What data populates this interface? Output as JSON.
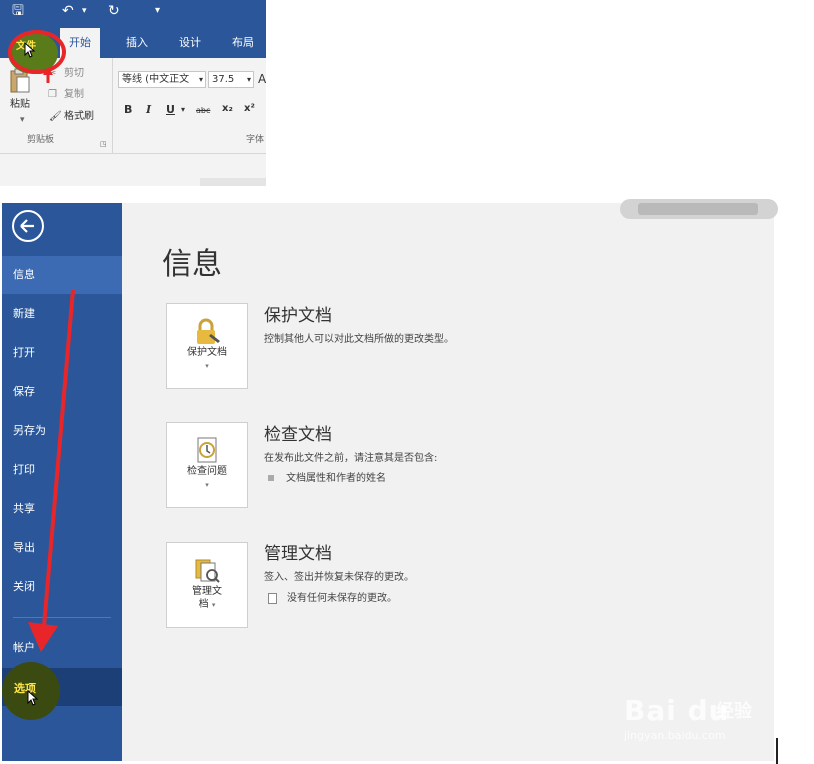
{
  "ribbon": {
    "tabs": {
      "file": "文件",
      "home": "开始",
      "insert": "插入",
      "design": "设计",
      "layout": "布局"
    },
    "clipboard": {
      "paste": "粘贴",
      "cut": "剪切",
      "copy": "复制",
      "format_painter": "格式刷",
      "group_label": "剪贴板"
    },
    "font": {
      "name": "等线 (中文正文",
      "size": "37.5",
      "group_label": "字体"
    },
    "format_buttons": {
      "bold": "B",
      "italic": "I",
      "underline": "U",
      "strike": "abc",
      "subscript": "x₂",
      "superscript": "x²"
    }
  },
  "backstage": {
    "nav": {
      "info": "信息",
      "new": "新建",
      "open": "打开",
      "save": "保存",
      "save_as": "另存为",
      "print": "打印",
      "share": "共享",
      "export": "导出",
      "close": "关闭",
      "account": "帐户",
      "options": "选项"
    },
    "title": "信息",
    "sections": {
      "protect": {
        "button_label": "保护文档",
        "title": "保护文档",
        "desc": "控制其他人可以对此文档所做的更改类型。"
      },
      "inspect": {
        "button_label": "检查问题",
        "title": "检查文档",
        "desc": "在发布此文件之前，请注意其是否包含:",
        "bullet": "文档属性和作者的姓名"
      },
      "manage": {
        "button_label_1": "管理文",
        "button_label_2": "档",
        "title": "管理文档",
        "desc": "签入、签出并恢复未保存的更改。",
        "bullet": "没有任何未保存的更改。"
      }
    }
  },
  "watermark": {
    "logo": "Bai du",
    "cn": "经验",
    "url": "jingyan.baidu.com"
  },
  "colors": {
    "word_blue": "#2b579a",
    "highlight_red": "#e8262a",
    "highlight_yellow": "#ffe44a"
  }
}
